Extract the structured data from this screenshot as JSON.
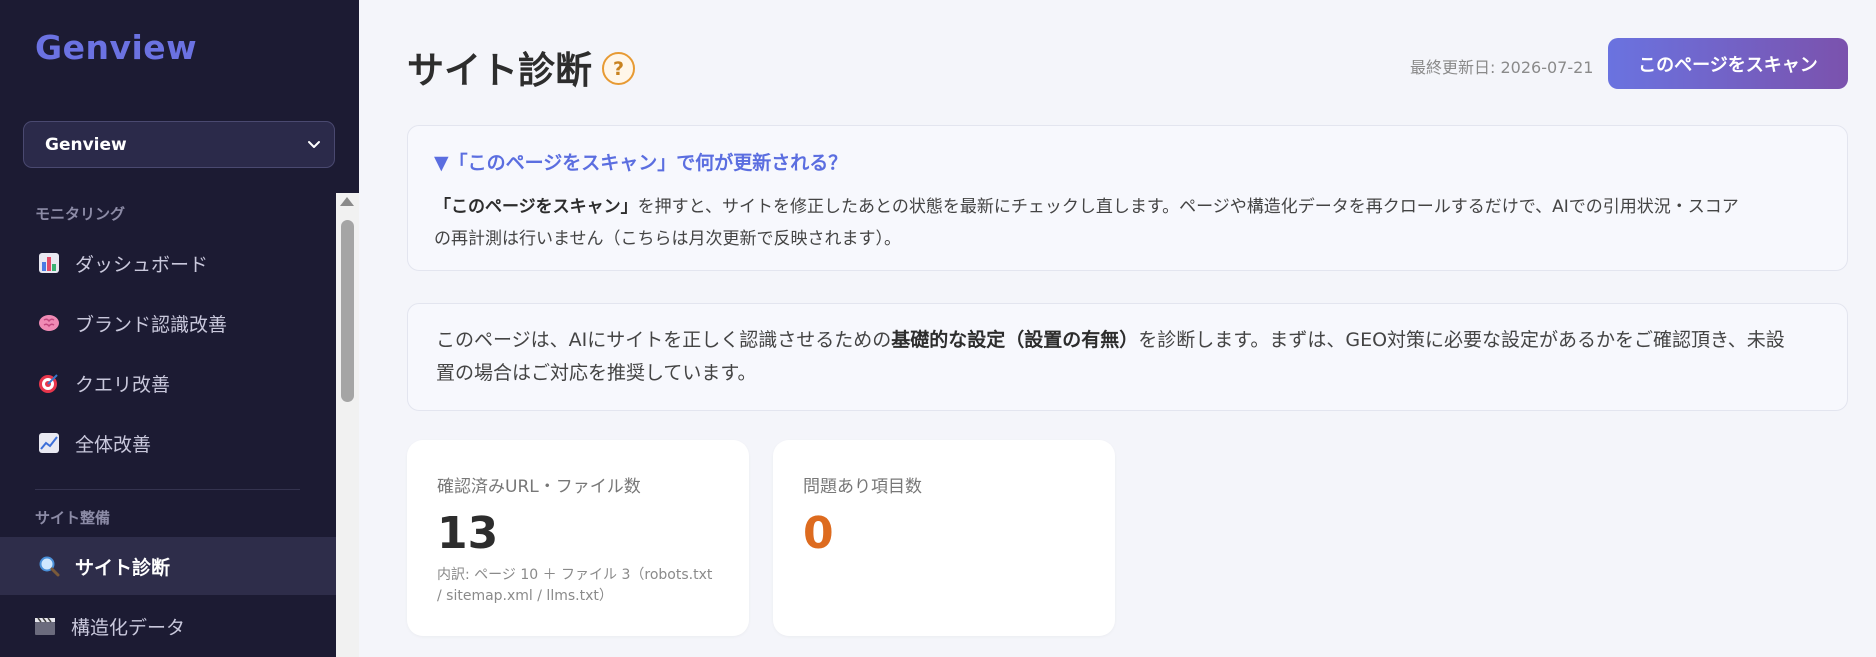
{
  "sidebar": {
    "brand": "Genview",
    "site_select": {
      "value": "Genview"
    },
    "sections": [
      {
        "label": "モニタリング",
        "items": [
          {
            "label": "ダッシュボード",
            "icon": "bar-chart-icon"
          },
          {
            "label": "ブランド認識改善",
            "icon": "brain-icon"
          },
          {
            "label": "クエリ改善",
            "icon": "target-icon"
          },
          {
            "label": "全体改善",
            "icon": "trending-up-icon"
          }
        ]
      },
      {
        "label": "サイト整備",
        "items": [
          {
            "label": "サイト診断",
            "icon": "magnifier-icon",
            "active": true
          },
          {
            "label": "構造化データ",
            "icon": "clapperboard-icon"
          }
        ]
      }
    ]
  },
  "header": {
    "title": "サイト診断",
    "help": "?",
    "last_updated": "最終更新日: 2026-07-21",
    "scan_button": "このページをスキャン"
  },
  "faq": {
    "title": "▼「このページをスキャン」で何が更新される？",
    "body_bold": "「このページをスキャン」",
    "body_line1": "を押すと、サイトを修正したあとの状態を最新にチェックし直します。ページや構造化データを再クロールするだけで、AIでの引用状況・スコア",
    "body_line2": "の再計測は行いません（こちらは月次更新で反映されます）。"
  },
  "intro": {
    "text_before": "このページは、AIにサイトを正しく認識させるための",
    "text_bold": "基礎的な設定（設置の有無）",
    "text_after_line1": "を診断します。まずは、GEO対策に必要な設定があるかをご確認頂き、未設",
    "text_line2": "置の場合はご対応を推奨しています。"
  },
  "stats": [
    {
      "label": "確認済みURL・ファイル数",
      "value": "13",
      "note_line1": "内訳: ページ 10 ＋ ファイル 3（robots.txt",
      "note_line2": "/ sitemap.xml / llms.txt）"
    },
    {
      "label": "問題あり項目数",
      "value": "0"
    }
  ],
  "colors": {
    "sidebar_bg": "#1c1b33",
    "brand": "#6b72e2",
    "accent": "#5b6ee0",
    "warn": "#dd6b1f",
    "button_gradient_start": "#6a73e0",
    "button_gradient_end": "#7b52ad"
  }
}
